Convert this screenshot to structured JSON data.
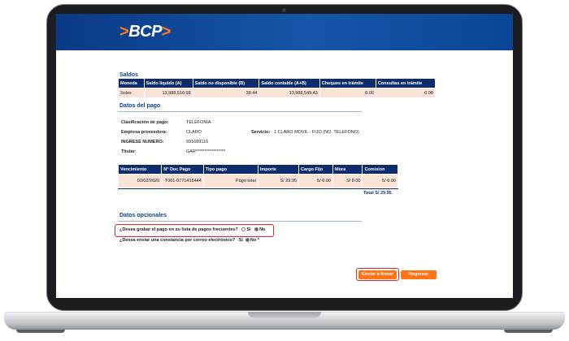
{
  "brand": {
    "logo_text": "BCP"
  },
  "saldos": {
    "title": "Saldos",
    "headers": [
      "Moneda",
      "Saldo líquido (A)",
      "Saldo no disponible (B)",
      "Saldo contable (A+B)",
      "Cheques en trámite",
      "Consultas en trámite"
    ],
    "row": [
      "Soles",
      "13,988,510.98",
      "38.44",
      "13,988,549.43",
      "0.00",
      "0.00"
    ]
  },
  "pago": {
    "title": "Datos del pago",
    "clasificacion_label": "Clasificación de pago:",
    "clasificacion_value": "TELEFONIA",
    "empresa_label": "Empresa proveedora:",
    "empresa_value": "CLARO",
    "servicio_label": "Servicio:",
    "servicio_value": "1 CLARO MOVIL - FIJO (NO. TELEFONO)",
    "ingrese_label": "INGRESE NUMERO:",
    "ingrese_value": "991689116",
    "titular_label": "Titular:",
    "titular_value": "GAR*****************"
  },
  "detalle": {
    "headers": [
      "Vencimiento",
      "N° Doc Pago",
      "Tipo pago",
      "Importe",
      "Cargo Fijo",
      "Mora",
      "Comision"
    ],
    "row": [
      "03/02/2020",
      "T001-0771418444",
      "Pago total",
      "S/ 29.95",
      "S/ 0.00",
      "S/ 0.00",
      "S/ 0.00"
    ],
    "total": "Total S/ 29.95"
  },
  "opcionales": {
    "title": "Datos opcionales",
    "q1": "¿Desea grabar el pago en su lista de pagos frecuentes?",
    "q2": "¿Desea enviar una constancia por correo electrónico?",
    "si": "Si",
    "no": "No",
    "no_star": "No *"
  },
  "buttons": {
    "enviar": "Enviar a firmar",
    "regresar": "Regresar"
  },
  "colors": {
    "header_blue": "#1655a8",
    "accent_orange": "#ff7417",
    "table_header": "#0d2c6c",
    "table_row": "#f9e2d6",
    "highlight_red": "#e0262a"
  }
}
